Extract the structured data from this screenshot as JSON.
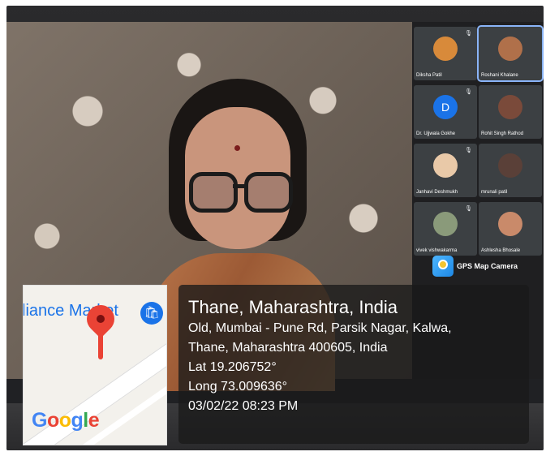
{
  "participants": [
    {
      "name": "Diksha Patil"
    },
    {
      "name": "Roshani Khalane"
    },
    {
      "name": "Dr. Ujjwala Gokhe",
      "initial": "D"
    },
    {
      "name": "Rohit Singh Rathod"
    },
    {
      "name": "Janhavi Deshmukh"
    },
    {
      "name": "mrunali patil"
    },
    {
      "name": "vivek vishwakarma"
    },
    {
      "name": "Ashlesha Bhosale"
    }
  ],
  "gps": {
    "app_label": "GPS Map Camera",
    "map_place": "liance Market",
    "map_brand": [
      "G",
      "o",
      "o",
      "g",
      "l",
      "e"
    ],
    "title": "Thane, Maharashtra, India",
    "address_line1": "Old, Mumbai - Pune Rd, Parsik Nagar, Kalwa,",
    "address_line2": "Thane, Maharashtra 400605, India",
    "lat": "Lat 19.206752°",
    "long": "Long 73.009636°",
    "datetime": "03/02/22 08:23 PM"
  },
  "colors": {
    "info_bg": "#191919",
    "map_pin": "#ea4335",
    "accent": "#1a73e8"
  }
}
